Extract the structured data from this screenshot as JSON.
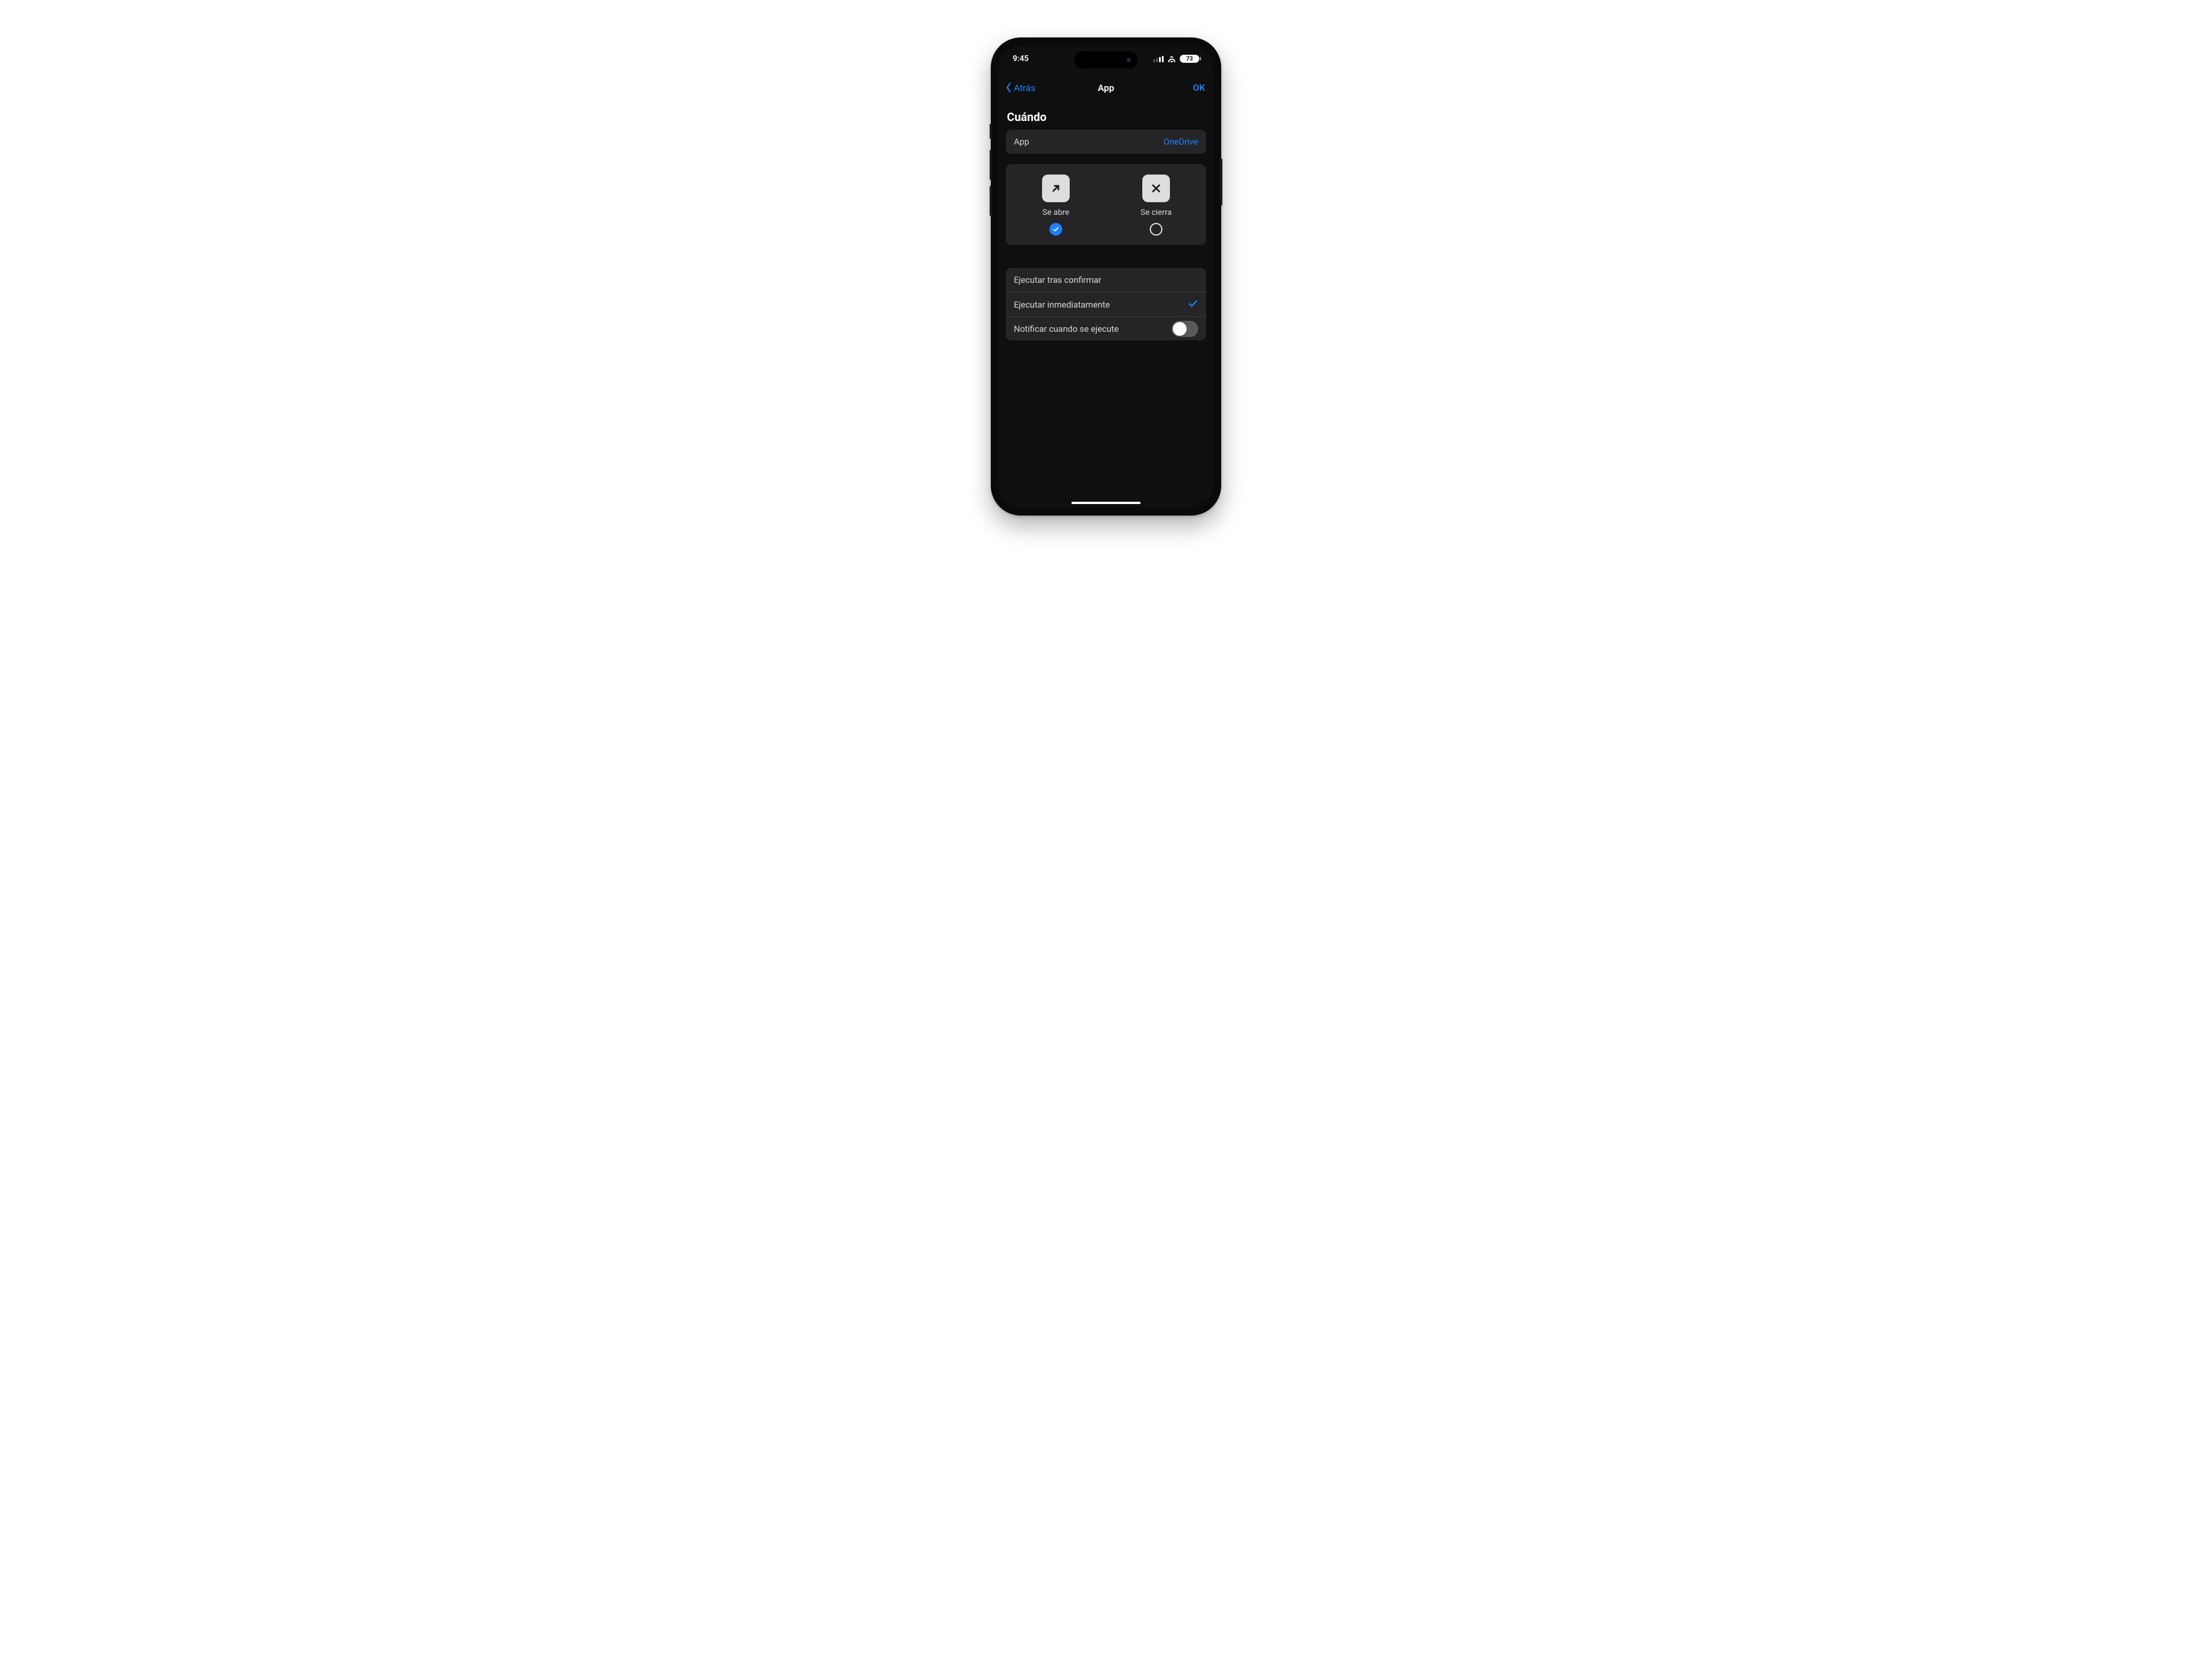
{
  "status": {
    "time": "9:45",
    "battery_pct": "73"
  },
  "nav": {
    "back_label": "Atrás",
    "title": "App",
    "done_label": "OK"
  },
  "section_title": "Cuándo",
  "app_row": {
    "label": "App",
    "value": "OneDrive"
  },
  "when": {
    "opens_label": "Se abre",
    "closes_label": "Se cierra",
    "selected": "opens"
  },
  "run": {
    "confirm_label": "Ejecutar tras confirmar",
    "immediate_label": "Ejecutar inmediatamente",
    "notify_label": "Notificar cuando se ejecute",
    "selected_mode": "immediate",
    "notify_on": false
  }
}
